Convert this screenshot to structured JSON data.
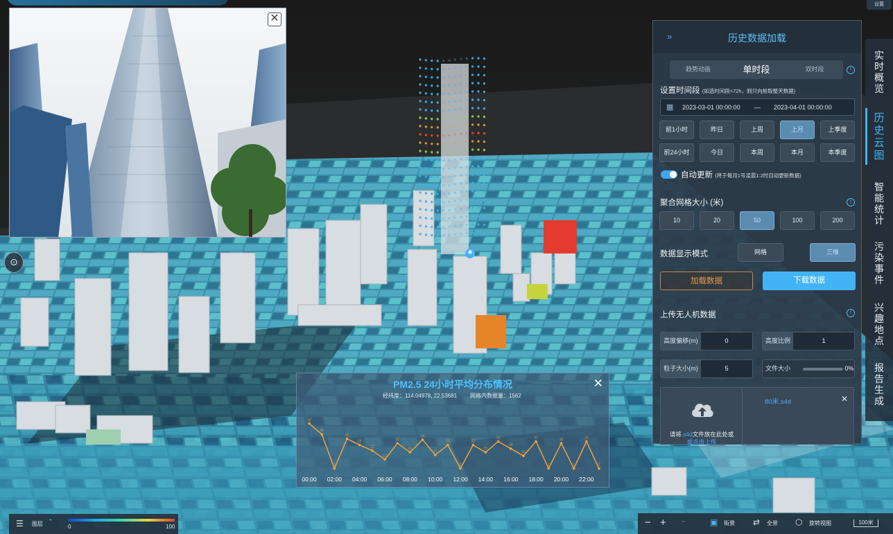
{
  "top": {
    "settings_label": "设置"
  },
  "photo": {
    "close_symbol": "✕"
  },
  "compass_icon": "compass-icon",
  "pm_chart": {
    "title": "PM2.5 24小时平均分布情况",
    "coordinates": "经纬度：114.04978, 22.53681",
    "grid_count": "网格内数据量：1562",
    "close_symbol": "✕"
  },
  "chart_data": {
    "type": "line",
    "title": "PM2.5 24小时平均分布情况",
    "x": [
      "00:00",
      "01:00",
      "02:00",
      "03:00",
      "04:00",
      "05:00",
      "06:00",
      "07:00",
      "08:00",
      "09:00",
      "10:00",
      "11:00",
      "12:00",
      "13:00",
      "14:00",
      "15:00",
      "16:00",
      "17:00",
      "18:00",
      "19:00",
      "20:00",
      "21:00",
      "22:00",
      "23:00"
    ],
    "x_tick_labels": [
      "00:00",
      "02:00",
      "04:00",
      "06:00",
      "08:00",
      "10:00",
      "12:00",
      "14:00",
      "16:00",
      "18:00",
      "20:00",
      "22:00"
    ],
    "values": [
      52,
      40,
      2,
      35,
      28,
      22,
      12,
      30,
      20,
      34,
      17,
      28,
      2,
      28,
      20,
      32,
      24,
      16,
      32,
      2,
      30,
      2,
      32,
      2
    ],
    "series": [
      {
        "name": "",
        "color": "#f0a23a",
        "values": [
          52,
          40,
          2,
          35,
          28,
          22,
          12,
          30,
          20,
          34,
          17,
          28,
          2,
          28,
          20,
          32,
          24,
          16,
          32,
          2,
          30,
          2,
          32,
          2
        ]
      }
    ],
    "ylim": [
      0,
      60
    ],
    "grid": false
  },
  "panel": {
    "title": "历史数据加载",
    "collapse_symbol": "»",
    "tabs": [
      {
        "label": "趋势动画"
      },
      {
        "label": "单时段"
      },
      {
        "label": "双时段"
      }
    ],
    "time_label": "设置时间段",
    "time_hint": "(如选时间段>72h，则只向前取整天数据)",
    "start_date": "2023-03-01 00:00:00",
    "date_sep": "—",
    "end_date": "2023-04-01 00:00:00",
    "quick_row1": [
      "前1小时",
      "昨日",
      "上周",
      "上月",
      "上季度"
    ],
    "quick_row2": [
      "前24小时",
      "今日",
      "本周",
      "本月",
      "本季度"
    ],
    "auto_update_label": "自动更新",
    "auto_update_hint": "(将于每月1号凌晨1:2时自动更新数据)",
    "grid_size_label": "聚合网格大小 (米)",
    "grid_sizes": [
      "10",
      "20",
      "50",
      "100",
      "200"
    ],
    "display_mode_label": "数据显示模式",
    "display_modes": [
      "网格",
      "三维"
    ],
    "load_button": "加载数据",
    "download_button": "下载数据",
    "upload_label": "上传无人机数据",
    "height_offset_label": "高度偏移(m)",
    "height_offset_value": "0",
    "height_ratio_label": "高度比例",
    "height_ratio_value": "1",
    "particle_size_label": "粒子大小(m)",
    "particle_size_value": "5",
    "file_size_label": "文件大小",
    "file_progress": "0%",
    "upload_hint_1": "请将",
    "upload_hint_ext": ".s4d",
    "upload_hint_2": "文件放在此处或",
    "upload_hint_link": "或点击上传",
    "file_name": "80米.s4d",
    "file_close": "✕",
    "info_symbol": "!"
  },
  "side_nav": [
    {
      "label": "实时概览"
    },
    {
      "label": "历史云图"
    },
    {
      "label": "智能统计"
    },
    {
      "label": "污染事件"
    },
    {
      "label": "兴趣地点"
    },
    {
      "label": "报告生成"
    }
  ],
  "legend": {
    "layers_label": "图层",
    "min": "0",
    "max": "100",
    "colors": [
      "#1446c8",
      "#23a6e9",
      "#3fd8a4",
      "#e9d83a",
      "#e8402a"
    ]
  },
  "tools": {
    "zoom_out": "−",
    "zoom_in": "+",
    "street_view": "街景",
    "full_view": "全景",
    "rotate_view": "旋转视图",
    "scale": "100米"
  }
}
